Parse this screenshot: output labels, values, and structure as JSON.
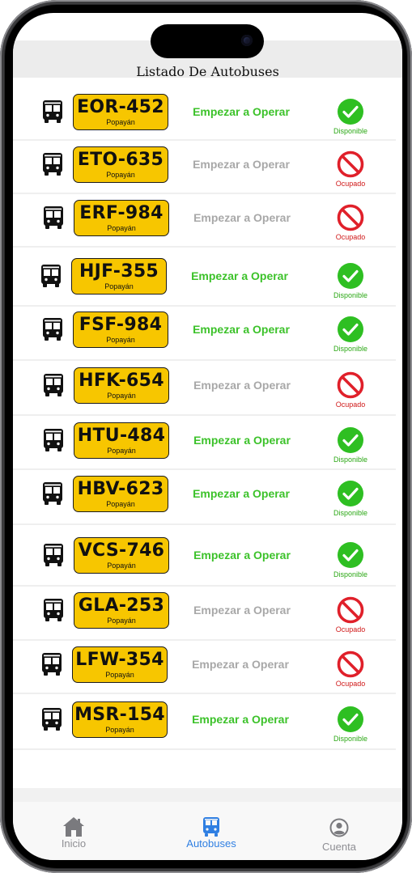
{
  "header": {
    "title": "Listado De Autobuses"
  },
  "colors": {
    "plate_yellow": "#f7c600",
    "available_green": "#3cc22a",
    "busy_red": "#d01a1a",
    "inactive_gray": "#a8a8a8",
    "tab_active_blue": "#2f7fe2"
  },
  "buses": [
    {
      "plate": "EOR-452",
      "city": "Popayán",
      "action": "Empezar a Operar",
      "status": "Disponible",
      "available": true
    },
    {
      "plate": "ETO-635",
      "city": "Popayán",
      "action": "Empezar a Operar",
      "status": "Ocupado",
      "available": false
    },
    {
      "plate": "ERF-984",
      "city": "Popayán",
      "action": "Empezar a Operar",
      "status": "Ocupado",
      "available": false
    },
    {
      "plate": "HJF-355",
      "city": "Popayán",
      "action": "Empezar a Operar",
      "status": "Disponible",
      "available": true
    },
    {
      "plate": "FSF-984",
      "city": "Popayán",
      "action": "Empezar a Operar",
      "status": "Disponible",
      "available": true
    },
    {
      "plate": "HFK-654",
      "city": "Popayán",
      "action": "Empezar a Operar",
      "status": "Ocupado",
      "available": false
    },
    {
      "plate": "HTU-484",
      "city": "Popayán",
      "action": "Empezar a Operar",
      "status": "Disponible",
      "available": true
    },
    {
      "plate": "HBV-623",
      "city": "Popayán",
      "action": "Empezar a Operar",
      "status": "Disponible",
      "available": true
    },
    {
      "plate": "VCS-746",
      "city": "Popayán",
      "action": "Empezar a Operar",
      "status": "Disponible",
      "available": true
    },
    {
      "plate": "GLA-253",
      "city": "Popayán",
      "action": "Empezar a Operar",
      "status": "Ocupado",
      "available": false
    },
    {
      "plate": "LFW-354",
      "city": "Popayán",
      "action": "Empezar a Operar",
      "status": "Ocupado",
      "available": false
    },
    {
      "plate": "MSR-154",
      "city": "Popayán",
      "action": "Empezar a Operar",
      "status": "Disponible",
      "available": true
    }
  ],
  "tabbar": {
    "tabs": [
      {
        "label": "Inicio",
        "icon": "home-icon",
        "active": false
      },
      {
        "label": "Autobuses",
        "icon": "bus-icon",
        "active": true
      },
      {
        "label": "Cuenta",
        "icon": "account-icon",
        "active": false
      }
    ]
  }
}
